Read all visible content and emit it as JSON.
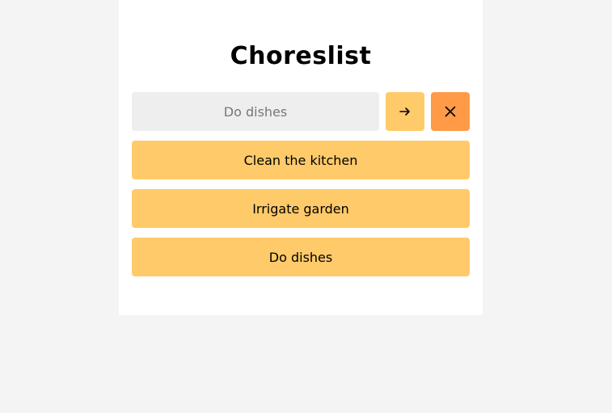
{
  "app": {
    "title": "Choreslist"
  },
  "form": {
    "input_value": "",
    "input_placeholder": "Do dishes",
    "submit_icon": "arrow-right-icon",
    "clear_icon": "close-icon"
  },
  "chores": [
    {
      "label": "Clean the kitchen"
    },
    {
      "label": "Irrigate garden"
    },
    {
      "label": "Do dishes"
    }
  ],
  "colors": {
    "page_background": "#f4f4f4",
    "card_background": "#ffffff",
    "input_background": "#eeeeee",
    "chore_background": "#ffca69",
    "submit_button": "#ffca69",
    "clear_button": "#ff9a48"
  }
}
